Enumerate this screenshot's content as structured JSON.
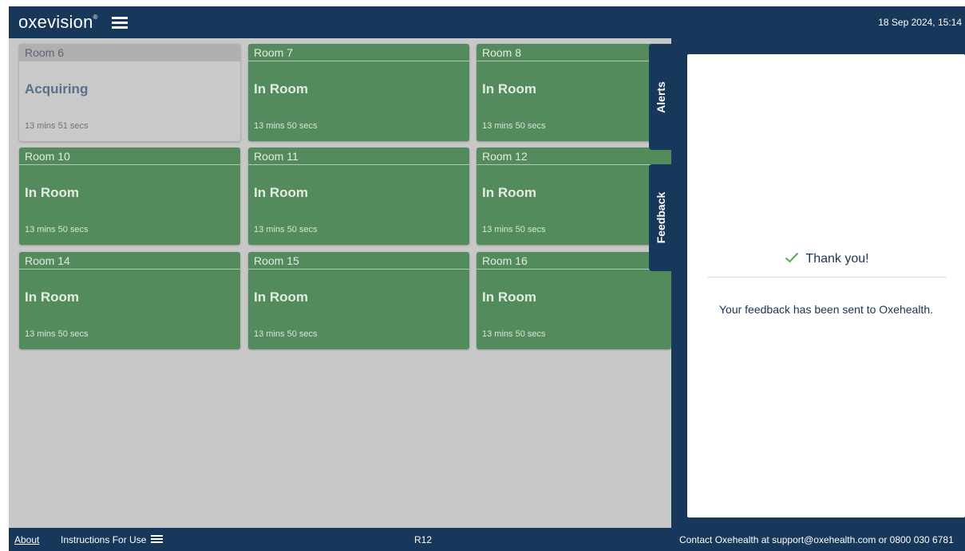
{
  "header": {
    "logo": "oxevision",
    "logo_mark": "®",
    "datetime": "18 Sep 2024, 15:14"
  },
  "rooms": [
    {
      "name": "Room 6",
      "status": "Acquiring",
      "time": "13 mins 51 secs"
    },
    {
      "name": "Room 7",
      "status": "In Room",
      "time": "13 mins 50 secs"
    },
    {
      "name": "Room 8",
      "status": "In Room",
      "time": "13 mins 50 secs"
    },
    {
      "name": "Room 10",
      "status": "In Room",
      "time": "13 mins 50 secs"
    },
    {
      "name": "Room 11",
      "status": "In Room",
      "time": "13 mins 50 secs"
    },
    {
      "name": "Room 12",
      "status": "In Room",
      "time": "13 mins 50 secs"
    },
    {
      "name": "Room 14",
      "status": "In Room",
      "time": "13 mins 50 secs"
    },
    {
      "name": "Room 15",
      "status": "In Room",
      "time": "13 mins 50 secs"
    },
    {
      "name": "Room 16",
      "status": "In Room",
      "time": "13 mins 50 secs"
    }
  ],
  "side_tabs": {
    "alerts": "Alerts",
    "feedback": "Feedback"
  },
  "panel": {
    "thanks_title": "Thank you!",
    "message": "Your feedback has been sent to Oxehealth."
  },
  "footer": {
    "about": "About",
    "instructions": "Instructions For Use",
    "code": "R12",
    "contact": "Contact Oxehealth at support@oxehealth.com or 0800 030 6781"
  },
  "colors": {
    "navy": "#17375b",
    "in_room_green": "#548b5d",
    "acquiring_grey": "#c9c9c9",
    "background_grey": "#c8c8c8"
  },
  "icons": [
    "menu-icon",
    "check-icon",
    "instructions-menu-icon"
  ]
}
